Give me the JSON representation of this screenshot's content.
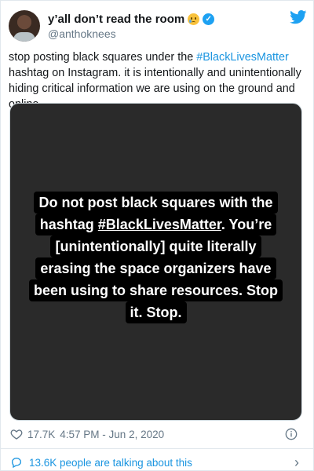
{
  "user": {
    "display_name": "y’all don’t read the room",
    "handle": "@anthoknees"
  },
  "tweet": {
    "text_part1": "stop posting black squares under the ",
    "hashtag": "#BlackLivesMatter",
    "text_part2": " hashtag on Instagram. it is intentionally and unintentionally hiding critical information we are using on the ground and online."
  },
  "media": {
    "lines": [
      "Do not post black squares with the",
      "hashtag ",
      "#BlackLivesMatter",
      ". You’re",
      "[unintentionally] quite literally",
      "erasing the space organizers have",
      "been using to share resources. Stop",
      "it. Stop."
    ]
  },
  "meta": {
    "likes": "17.7K",
    "timestamp": "4:57 PM - Jun 2, 2020"
  },
  "footer": {
    "talking": "13.6K people are talking about this"
  },
  "icons": {
    "accent": "#1da1f2",
    "heart": "heart-icon",
    "info": "info-icon",
    "bubble": "comment-bubble-icon",
    "chevron": "chevron-right-icon"
  }
}
